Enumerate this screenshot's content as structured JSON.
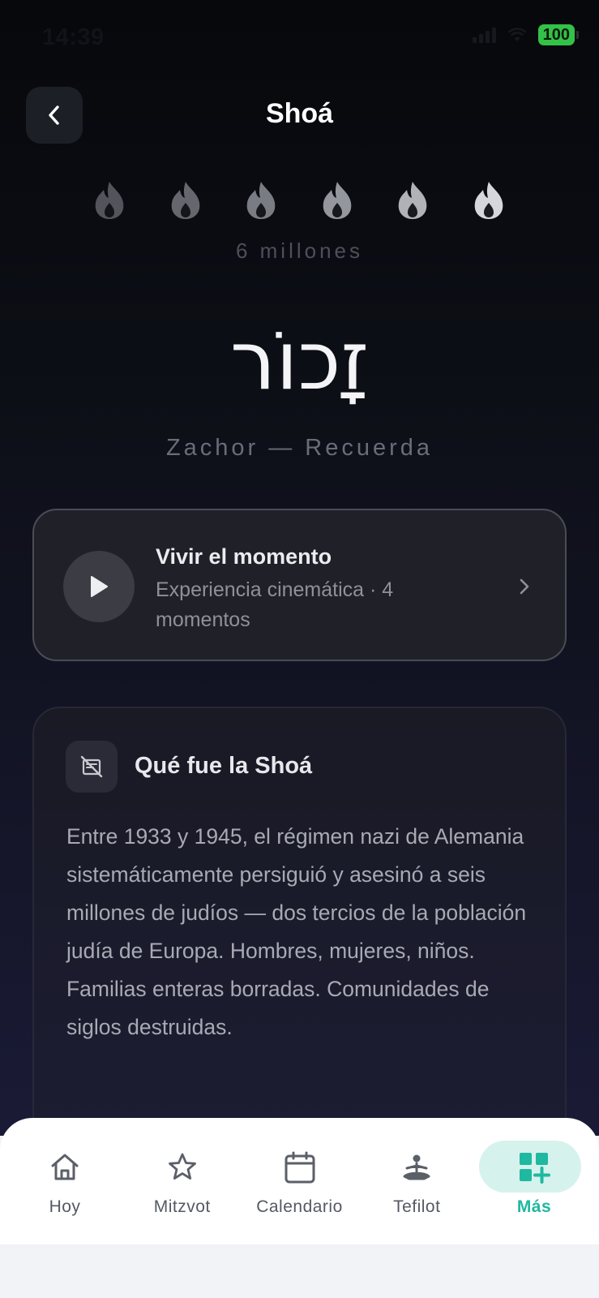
{
  "status_bar": {
    "time": "14:39",
    "battery": "100"
  },
  "header": {
    "title": "Shoá",
    "back_icon": "chevron-left-icon"
  },
  "memorial": {
    "flame_icon": "flame-icon",
    "flame_count": 6,
    "caption": "6 millones",
    "hebrew": "זָכוֹר",
    "subtitle": "Zachor — Recuerda"
  },
  "moment_card": {
    "title": "Vivir el momento",
    "description": "Experiencia cinemática · 4 momentos",
    "play_icon": "play-icon",
    "chevron_icon": "chevron-right-icon"
  },
  "info_card": {
    "icon": "history-icon",
    "title": "Qué fue la Shoá",
    "body": "Entre 1933 y 1945, el régimen nazi de Alemania sistemáticamente persiguió y asesinó a seis millones de judíos — dos tercios de la población judía de Europa. Hombres, mujeres, niños. Familias enteras borradas. Comunidades de siglos destruidas."
  },
  "tab_bar": {
    "items": [
      {
        "label": "Hoy",
        "icon": "home-icon"
      },
      {
        "label": "Mitzvot",
        "icon": "star-icon"
      },
      {
        "label": "Calendario",
        "icon": "calendar-icon"
      },
      {
        "label": "Tefilot",
        "icon": "prayer-icon"
      },
      {
        "label": "Más",
        "icon": "grid-plus-icon",
        "active": true
      }
    ],
    "accent_color": "#1fb8a0"
  }
}
